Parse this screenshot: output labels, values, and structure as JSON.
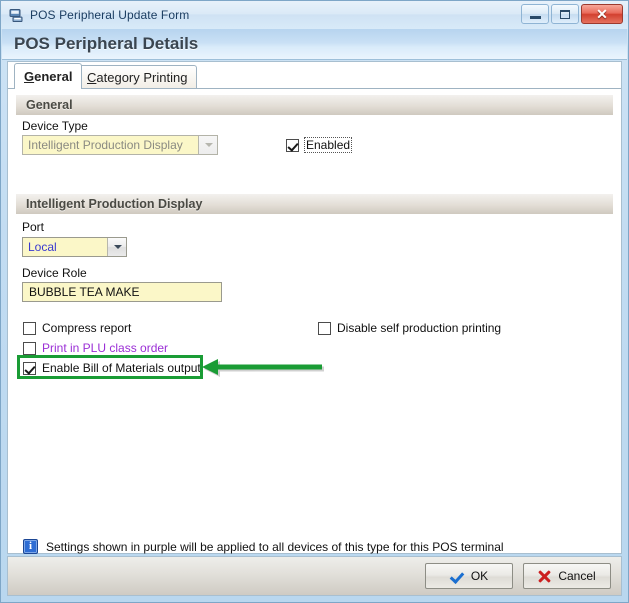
{
  "window": {
    "title": "POS Peripheral Update Form",
    "icon": "pos-peripheral-icon",
    "header": "POS Peripheral Details",
    "buttons": {
      "minimize": "minimize-button",
      "maximize": "maximize-button",
      "close_glyph": "✕"
    }
  },
  "tabs": [
    {
      "label": "General",
      "accel": "G",
      "rest": "eneral",
      "active": true
    },
    {
      "label": "Category Printing",
      "accel": "C",
      "rest": "ategory Printing",
      "active": false
    }
  ],
  "groups": {
    "general": "General",
    "device": "Intelligent Production Display"
  },
  "fields": {
    "device_type": {
      "label": "Device Type",
      "value": "Intelligent Production Display",
      "disabled": true
    },
    "enabled": {
      "label": "Enabled",
      "checked": true,
      "focused": true
    },
    "port": {
      "label": "Port",
      "value": "Local",
      "value_color": "#3a3ad0"
    },
    "device_role": {
      "label": "Device Role",
      "value": "BUBBLE TEA MAKE"
    }
  },
  "checkboxes": [
    {
      "label": "Compress report",
      "checked": false,
      "purple": false
    },
    {
      "label": "Print in PLU class order",
      "checked": false,
      "purple": true
    },
    {
      "label": "Enable Bill of Materials output",
      "checked": true,
      "purple": false,
      "highlighted": true
    },
    {
      "label": "Disable self production printing",
      "checked": false,
      "purple": false
    }
  ],
  "info": {
    "icon": "information-icon",
    "text": "Settings shown in purple will be applied to all devices of this type for this POS terminal"
  },
  "dialog_buttons": [
    {
      "label": "OK",
      "icon": "check-icon"
    },
    {
      "label": "Cancel",
      "icon": "cross-icon"
    }
  ],
  "annotation": {
    "highlight_color": "#1a9c35",
    "arrow": "left-arrow-annotation",
    "target": "Enable Bill of Materials output"
  },
  "colors": {
    "accent_purple": "#9b2fd6",
    "annotation_green": "#1a9c35",
    "field_yellow": "#fbf7c8",
    "ok_blue": "#1b6fd0",
    "cancel_red": "#cc1f1f"
  }
}
